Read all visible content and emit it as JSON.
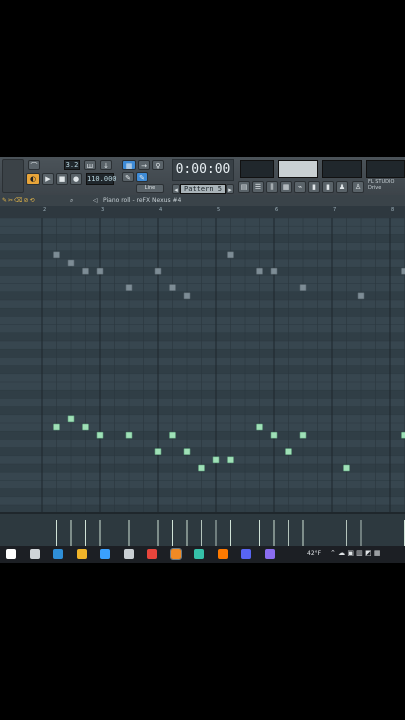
{
  "app": "FL Studio",
  "toolbar": {
    "pattern_label": "Pattern 5",
    "time_display": "0:00:00",
    "tempo": "110.000",
    "beat_display": "3.2",
    "fl_studio_label": "FL STUDIO",
    "drive_label": "Drive",
    "snap_label": "Line"
  },
  "piano_roll": {
    "title": "Piano roll - reFX Nexus #4",
    "bar_numbers": [
      "2",
      "3",
      "4",
      "5",
      "6",
      "7",
      "8"
    ]
  },
  "notes": [
    {
      "t": 0.25,
      "p": 68
    },
    {
      "t": 0.5,
      "p": 67
    },
    {
      "t": 0.75,
      "p": 66
    },
    {
      "t": 1.0,
      "p": 66
    },
    {
      "t": 1.5,
      "p": 64
    },
    {
      "t": 2.0,
      "p": 66
    },
    {
      "t": 2.25,
      "p": 64
    },
    {
      "t": 2.5,
      "p": 63
    },
    {
      "t": 3.25,
      "p": 68
    },
    {
      "t": 3.75,
      "p": 66
    },
    {
      "t": 4.0,
      "p": 66
    },
    {
      "t": 4.5,
      "p": 64
    },
    {
      "t": 5.5,
      "p": 63
    },
    {
      "t": 6.25,
      "p": 66
    },
    {
      "t": 6.5,
      "p": 63
    },
    {
      "t": 6.75,
      "p": 62
    },
    {
      "t": 0.25,
      "p": 47
    },
    {
      "t": 0.5,
      "p": 48
    },
    {
      "t": 0.75,
      "p": 47
    },
    {
      "t": 1.0,
      "p": 46
    },
    {
      "t": 1.5,
      "p": 46
    },
    {
      "t": 2.0,
      "p": 44
    },
    {
      "t": 2.25,
      "p": 46
    },
    {
      "t": 2.5,
      "p": 44
    },
    {
      "t": 2.75,
      "p": 42
    },
    {
      "t": 3.0,
      "p": 43
    },
    {
      "t": 3.25,
      "p": 43
    },
    {
      "t": 3.75,
      "p": 47
    },
    {
      "t": 4.0,
      "p": 46
    },
    {
      "t": 4.25,
      "p": 44
    },
    {
      "t": 4.5,
      "p": 46
    },
    {
      "t": 5.25,
      "p": 42
    },
    {
      "t": 6.25,
      "p": 46
    },
    {
      "t": 6.5,
      "p": 44
    },
    {
      "t": 6.75,
      "p": 42
    },
    {
      "t": 6.9,
      "p": 43
    }
  ],
  "taskbar": {
    "weather": "42°F",
    "icons": [
      "start-icon",
      "search-icon",
      "edge-icon",
      "store-icon",
      "explorer-icon",
      "settings-icon",
      "chrome-icon",
      "fl-studio-icon",
      "terminal-icon",
      "illustrator-icon",
      "discord-icon",
      "obs-icon"
    ]
  },
  "colors": {
    "note_fill": "#9fe0b7",
    "note_border": "#5fa07c",
    "grid_bg": "#34434c",
    "ghost_note": "#7d8c95"
  }
}
